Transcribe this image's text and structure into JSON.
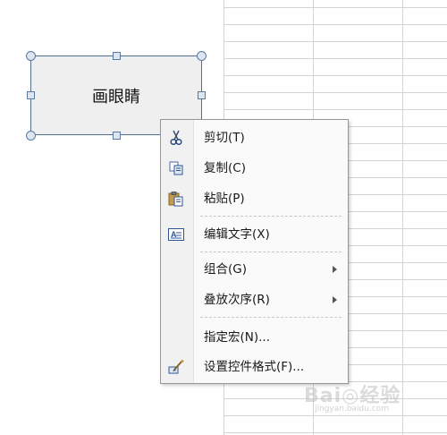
{
  "shape": {
    "label": "画眼睛"
  },
  "menu": {
    "items": [
      {
        "label": "剪切(T)",
        "icon": "scissors-icon",
        "submenu": false
      },
      {
        "label": "复制(C)",
        "icon": "copy-icon",
        "submenu": false
      },
      {
        "label": "粘贴(P)",
        "icon": "paste-icon",
        "submenu": false
      },
      {
        "label": "编辑文字(X)",
        "icon": "edit-text-icon",
        "submenu": false
      },
      {
        "label": "组合(G)",
        "icon": "",
        "submenu": true
      },
      {
        "label": "叠放次序(R)",
        "icon": "",
        "submenu": true
      },
      {
        "label": "指定宏(N)...",
        "icon": "",
        "submenu": false
      },
      {
        "label": "设置控件格式(F)...",
        "icon": "format-control-icon",
        "submenu": false
      }
    ]
  },
  "watermark": {
    "text": "Bai◎经验",
    "url": "jingyan.baidu.com"
  }
}
